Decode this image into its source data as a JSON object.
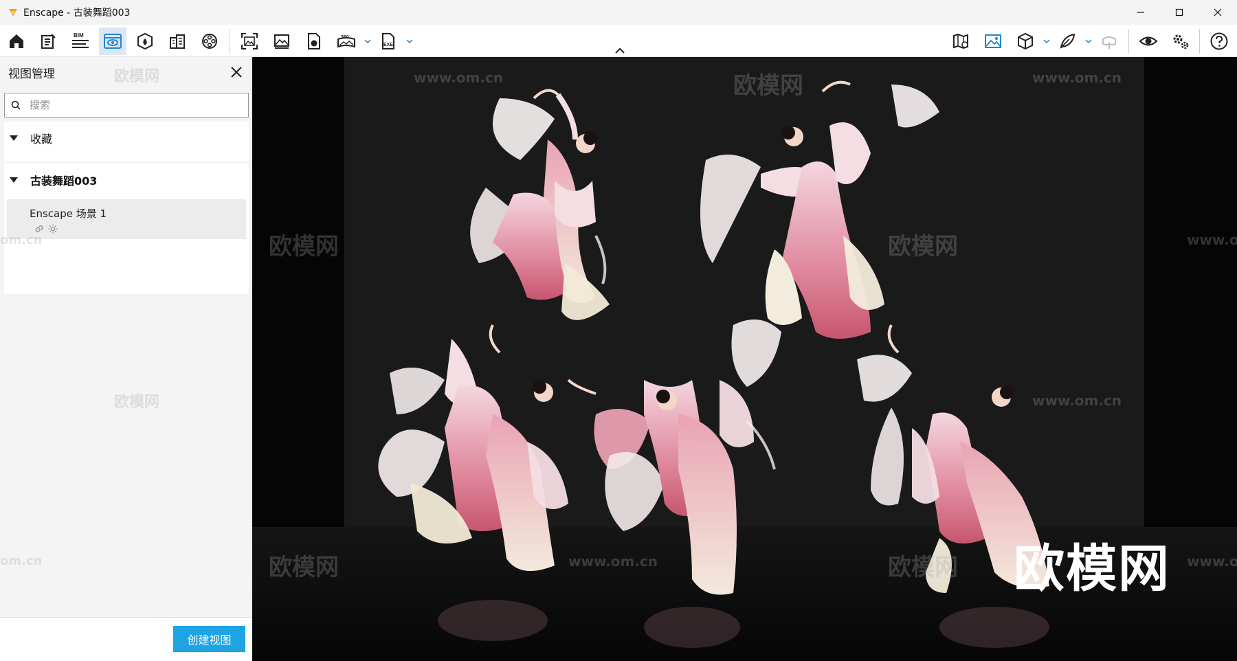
{
  "window": {
    "title": "Enscape - 古装舞蹈003",
    "controls": [
      "minimize-icon",
      "maximize-icon",
      "close-icon"
    ]
  },
  "toolbar": {
    "left_buttons": [
      {
        "icon": "home-icon",
        "active": false
      },
      {
        "icon": "notes-icon",
        "active": false
      },
      {
        "icon": "bim-icon",
        "label": "BIM",
        "active": false
      },
      {
        "icon": "views-eye-icon",
        "active": true
      },
      {
        "icon": "asset-library-icon",
        "active": false
      },
      {
        "icon": "material-editor-icon",
        "active": false
      },
      {
        "icon": "video-editor-icon",
        "active": false
      },
      {
        "icon": "screenshot-icon",
        "active": false
      },
      {
        "icon": "batch-render-icon",
        "active": false
      },
      {
        "icon": "web-export-icon",
        "active": false
      },
      {
        "icon": "panorama-360-icon",
        "label": "360",
        "active": false
      },
      {
        "icon": "exe-export-icon",
        "label": "EXE",
        "active": false
      }
    ],
    "right_buttons": [
      {
        "icon": "map-settings-icon",
        "active": false
      },
      {
        "icon": "visual-settings-icon",
        "active": false
      },
      {
        "icon": "cube-view-icon",
        "active": false
      },
      {
        "icon": "feather-icon",
        "active": false
      },
      {
        "icon": "vr-headset-icon",
        "active": false
      },
      {
        "icon": "eye-icon",
        "active": false
      },
      {
        "icon": "settings-gears-icon",
        "active": false
      },
      {
        "icon": "help-icon",
        "active": false
      }
    ],
    "accent": "#1ea3e3"
  },
  "panel": {
    "title": "视图管理",
    "search_placeholder": "搜索",
    "favorites_label": "收藏",
    "project_label": "古装舞蹈003",
    "view_item": {
      "name": "Enscape 场景 1",
      "icons": [
        "link-icon",
        "sun-icon"
      ]
    },
    "create_button": "创建视图"
  },
  "viewport": {
    "watermarks": [
      "欧模网",
      "www.om.cn"
    ],
    "logo_text": "欧模网"
  }
}
